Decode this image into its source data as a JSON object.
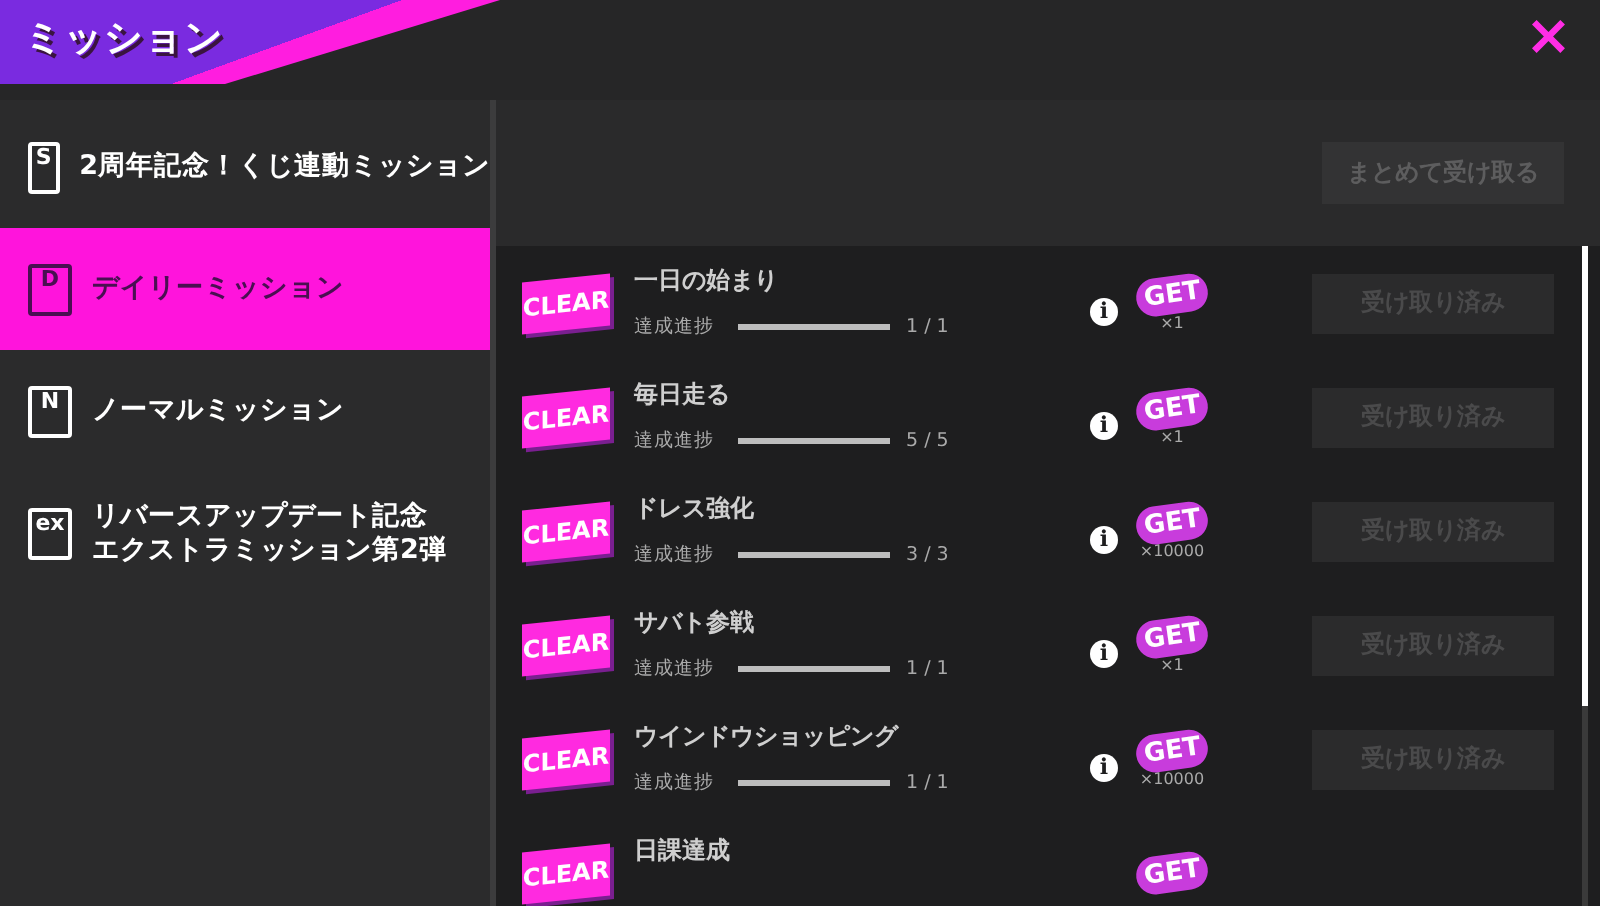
{
  "header": {
    "title": "ミッション",
    "close": "×"
  },
  "sidebar": {
    "items": [
      {
        "icon_label": "S",
        "lines": [
          "2周年記念！くじ連動ミッション"
        ],
        "selected": false
      },
      {
        "icon_label": "D",
        "lines": [
          "デイリーミッション"
        ],
        "selected": true
      },
      {
        "icon_label": "N",
        "lines": [
          "ノーマルミッション"
        ],
        "selected": false
      },
      {
        "icon_label": "ex",
        "lines": [
          "リバースアップデート記念",
          "エクストラミッション第2弾"
        ],
        "selected": false
      }
    ]
  },
  "collect_all": "まとめて受け取る",
  "missions": [
    {
      "badge": "CLEAR",
      "title": "一日の始まり",
      "progress_label": "達成進捗",
      "level": 1,
      "progress": "1 / 1",
      "info": "i",
      "reward": "GET",
      "quantity": "×1",
      "claim": "受け取り済み"
    },
    {
      "badge": "CLEAR",
      "title": "毎日走る",
      "progress_label": "達成進捗",
      "level": 1,
      "progress": "5 / 5",
      "info": "i",
      "reward": "GET",
      "quantity": "×1",
      "claim": "受け取り済み"
    },
    {
      "badge": "CLEAR",
      "title": "ドレス強化",
      "progress_label": "達成進捗",
      "level": 1,
      "progress": "3 / 3",
      "info": "i",
      "reward": "GET",
      "quantity": "×10000",
      "claim": "受け取り済み"
    },
    {
      "badge": "CLEAR",
      "title": "サバト参戦",
      "progress_label": "達成進捗",
      "level": 1,
      "progress": "1 / 1",
      "info": "i",
      "reward": "GET",
      "quantity": "×1",
      "claim": "受け取り済み"
    },
    {
      "badge": "CLEAR",
      "title": "ウインドウショッピング",
      "progress_label": "達成進捗",
      "level": 1,
      "progress": "1 / 1",
      "info": "i",
      "reward": "GET",
      "quantity": "×10000",
      "claim": "受け取り済み"
    },
    {
      "badge": "CLEAR",
      "title": "日課達成",
      "reward": "GET"
    }
  ]
}
